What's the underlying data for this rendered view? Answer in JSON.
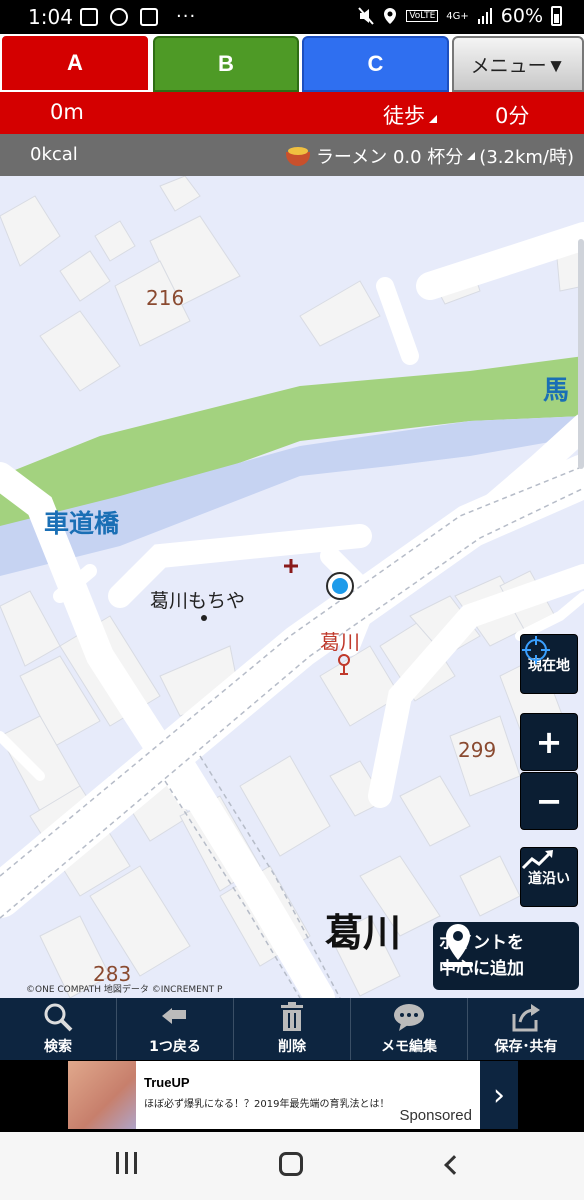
{
  "status_bar": {
    "time": "1:04",
    "dots": "···",
    "network_4g": "4G+",
    "volte": "VoLTE",
    "battery": "60%"
  },
  "tabs": {
    "a_label": "A",
    "b_label": "B",
    "c_label": "C",
    "menu_label": "メニュー▼"
  },
  "route_info": {
    "distance": "0m",
    "mode": "徒歩",
    "duration": "0分"
  },
  "calorie_info": {
    "kcal": "0kcal",
    "food_equivalent": "ラーメン 0.0 杯分",
    "speed": "(3.2km/時)"
  },
  "map": {
    "labels": {
      "num_216": "216",
      "num_299": "299",
      "num_283": "283",
      "shadomichi_bridge": "車道橋",
      "uma": "馬",
      "katsukawa_mochiya": "葛川もちや",
      "katsukawa_stop": "葛川",
      "katsukawa_area": "葛川"
    },
    "copyright": "©ONE COMPATH 地図データ ©INCREMENT P",
    "buttons": {
      "current_location": "現在地",
      "zoom_in": "+",
      "zoom_out": "−",
      "along_road": "道沿い",
      "add_point_line1": "ポイントを",
      "add_point_line2": "中心に追加"
    },
    "colors": {
      "land": "#e7ebfa",
      "river": "#c6d3f2",
      "park": "#a3d27f",
      "road": "#ffffff",
      "building": "#f3f3f3",
      "label_blue": "#1a6fb5",
      "label_brown": "#8a4a30",
      "poi_red": "#c0392b",
      "location_dot": "#1e9bea"
    }
  },
  "toolbar": {
    "search": "検索",
    "undo": "1つ戻る",
    "delete": "削除",
    "memo_edit": "メモ編集",
    "save_share": "保存･共有"
  },
  "ad": {
    "title": "TrueUP",
    "description": "ほぼ必ず爆乳になる！？2019年最先端の育乳法とは！",
    "sponsored": "Sponsored",
    "arrow": "›"
  }
}
